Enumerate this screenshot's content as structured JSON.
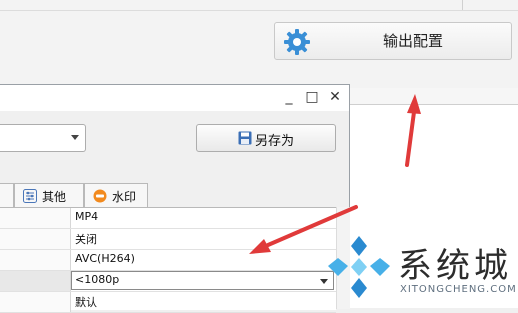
{
  "toolbar": {
    "output_config_label": "输出配置",
    "output_config_icon": "gear-icon"
  },
  "dialog": {
    "window_controls": {
      "minimize": "_",
      "maximize": "□",
      "close": "✕"
    },
    "save_as_label": "另存为",
    "save_as_icon": "floppy-disk-icon",
    "tabs": [
      {
        "label": "其他",
        "icon": "sliders-icon"
      },
      {
        "label": "水印",
        "icon": "new-badge-icon"
      }
    ],
    "rows": [
      {
        "value": "MP4"
      },
      {
        "value": "关闭"
      },
      {
        "value": "AVC(H264)"
      },
      {
        "value": "<1080p",
        "selected": true
      },
      {
        "value": "默认"
      }
    ]
  },
  "watermark": {
    "brand": "系统城",
    "domain": "XITONGCHENG.COM"
  },
  "colors": {
    "arrow_red": "#e03a3a",
    "gear_blue": "#3a8fd6",
    "logo_blue": "#2a8ad0"
  }
}
